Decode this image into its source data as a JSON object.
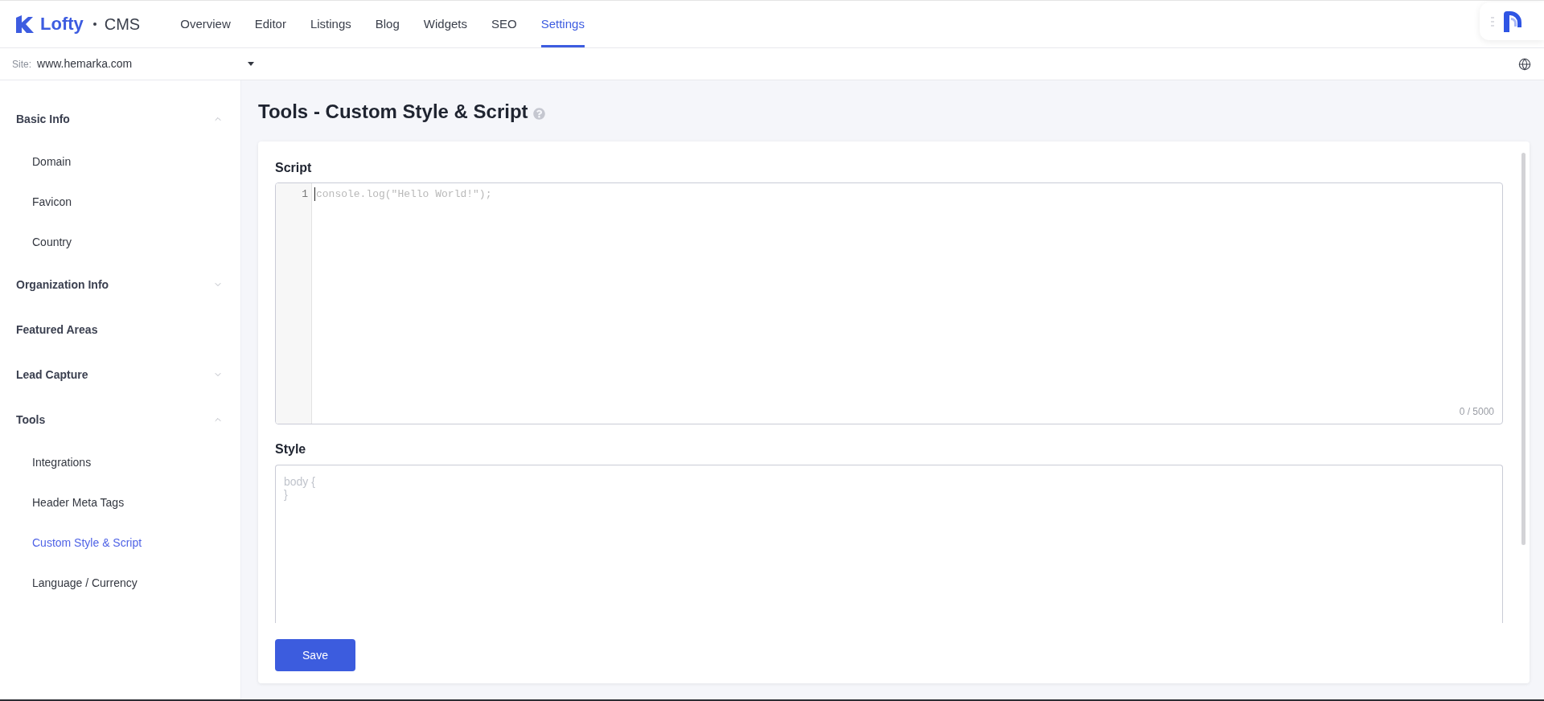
{
  "header": {
    "logo": {
      "name": "Lofty",
      "product": "CMS"
    },
    "nav": [
      {
        "label": "Overview",
        "selected": false
      },
      {
        "label": "Editor",
        "selected": false
      },
      {
        "label": "Listings",
        "selected": false
      },
      {
        "label": "Blog",
        "selected": false
      },
      {
        "label": "Widgets",
        "selected": false
      },
      {
        "label": "SEO",
        "selected": false
      },
      {
        "label": "Settings",
        "selected": true
      }
    ]
  },
  "site_bar": {
    "label": "Site:",
    "value": "www.hemarka.com"
  },
  "sidebar": {
    "groups": [
      {
        "label": "Basic Info",
        "kind": "group",
        "expanded": true,
        "children": [
          {
            "label": "Domain",
            "selected": false
          },
          {
            "label": "Favicon",
            "selected": false
          },
          {
            "label": "Country",
            "selected": false
          }
        ]
      },
      {
        "label": "Organization Info",
        "kind": "group",
        "expanded": false
      },
      {
        "label": "Featured Areas",
        "kind": "link"
      },
      {
        "label": "Lead Capture",
        "kind": "group",
        "expanded": false
      },
      {
        "label": "Tools",
        "kind": "group",
        "expanded": true,
        "children": [
          {
            "label": "Integrations",
            "selected": false
          },
          {
            "label": "Header Meta Tags",
            "selected": false
          },
          {
            "label": "Custom Style & Script",
            "selected": true
          },
          {
            "label": "Language / Currency",
            "selected": false
          }
        ]
      }
    ]
  },
  "page": {
    "title": "Tools - Custom Style & Script"
  },
  "script": {
    "label": "Script",
    "line_numbers": [
      "1"
    ],
    "placeholder": "console.log(\"Hello World!\");",
    "focused": true,
    "counter": "0 / 5000"
  },
  "style": {
    "label": "Style",
    "placeholder": "body {\n}"
  },
  "save_button": "Save"
}
